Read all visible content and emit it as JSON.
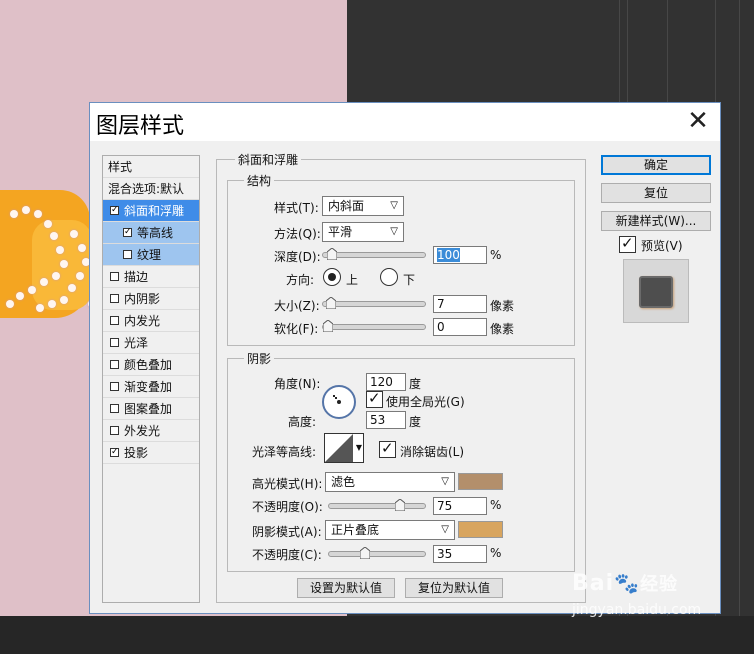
{
  "dialog": {
    "title": "图层样式",
    "close_glyph": "✕",
    "list_header": "样式",
    "blend_options": "混合选项:默认",
    "styles": [
      {
        "label": "斜面和浮雕",
        "checked": true,
        "selected": true
      },
      {
        "label": "等高线",
        "checked": true,
        "sub": true
      },
      {
        "label": "纹理",
        "checked": false,
        "sub": true
      },
      {
        "label": "描边",
        "checked": false
      },
      {
        "label": "内阴影",
        "checked": false
      },
      {
        "label": "内发光",
        "checked": false
      },
      {
        "label": "光泽",
        "checked": false
      },
      {
        "label": "颜色叠加",
        "checked": false
      },
      {
        "label": "渐变叠加",
        "checked": false
      },
      {
        "label": "图案叠加",
        "checked": false
      },
      {
        "label": "外发光",
        "checked": false
      },
      {
        "label": "投影",
        "checked": true
      }
    ],
    "check_glyph": "✓"
  },
  "bevel": {
    "group_title": "斜面和浮雕",
    "structure_title": "结构",
    "style_label": "样式(T):",
    "style_value": "内斜面",
    "technique_label": "方法(Q):",
    "technique_value": "平滑",
    "depth_label": "深度(D):",
    "depth_value": "100",
    "depth_level": 0.04,
    "percent": "%",
    "direction_label": "方向:",
    "dir_up": "上",
    "dir_down": "下",
    "size_label": "大小(Z):",
    "size_value": "7",
    "size_level": 0.03,
    "px_unit": "像素",
    "soften_label": "软化(F):",
    "soften_value": "0",
    "soften_level": 0.0
  },
  "shading": {
    "group_title": "阴影",
    "angle_label": "角度(N):",
    "angle_value": "120",
    "degree": "度",
    "global_light": "使用全局光(G)",
    "altitude_label": "高度:",
    "altitude_value": "53",
    "gloss_label": "光泽等高线:",
    "antialias": "消除锯齿(L)",
    "highlight_label": "高光模式(H):",
    "highlight_value": "滤色",
    "highlight_color": "#b38f6b",
    "hl_opacity_label": "不透明度(O):",
    "hl_opacity_value": "75",
    "hl_opacity_level": 0.75,
    "shadow_label": "阴影模式(A):",
    "shadow_value": "正片叠底",
    "shadow_color": "#d8a55f",
    "sh_opacity_label": "不透明度(C):",
    "sh_opacity_value": "35",
    "sh_opacity_level": 0.35
  },
  "buttons": {
    "ok": "确定",
    "reset": "复位",
    "new_style": "新建样式(W)...",
    "preview": "预览(V)",
    "make_default": "设置为默认值",
    "reset_default": "复位为默认值"
  },
  "watermark": {
    "brand": "Bai",
    "brand2": "经验",
    "url": "jingyan.baidu.com"
  }
}
